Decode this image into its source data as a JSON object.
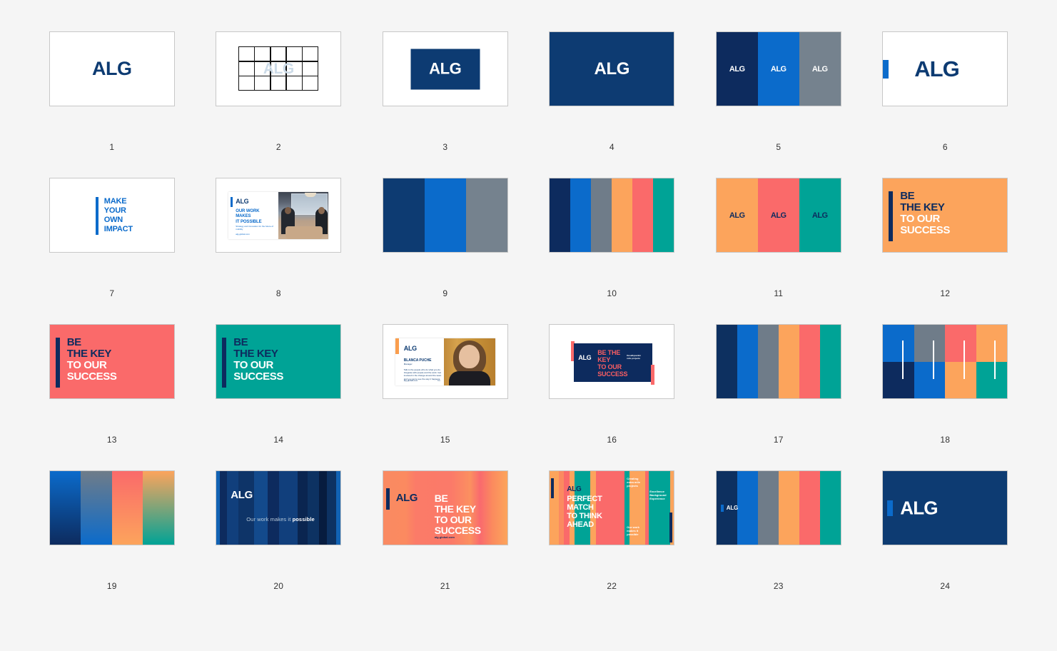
{
  "palette": {
    "page_background": "#f5f5f5",
    "navy": "#0d3b72",
    "deep_navy": "#0d2b5e",
    "blue": "#0b6bcb",
    "grey_blue": "#75828e",
    "orange": "#fca45c",
    "coral": "#fa6a6a",
    "teal": "#00a396",
    "caption_color": "#333333",
    "border": "#c8c8c8"
  },
  "brand": {
    "logo": "ALG",
    "tagline": "Our work makes it possible",
    "tagline_prefix": "Our work makes it ",
    "tagline_bold": "possible",
    "website": "alg-global.com"
  },
  "slogans": {
    "make_your_own_impact": [
      "MAKE",
      "YOUR",
      "OWN",
      "IMPACT"
    ],
    "be_the_key_dark": [
      "BE",
      "THE KEY"
    ],
    "be_the_key_light": [
      "TO OUR",
      "SUCCESS"
    ],
    "perfect_match": [
      "PERFECT",
      "MATCH",
      "TO THINK",
      "AHEAD"
    ],
    "our_work_makes_it_possible": [
      "OUR WORK",
      "MAKES",
      "IT POSSIBLE"
    ],
    "be_the_key_all": [
      "BE",
      "THE KEY",
      "TO OUR",
      "SUCCESS"
    ],
    "be_the_key_t16": [
      "BE THE",
      "KEY",
      "TO OUR",
      "SUCCESS"
    ]
  },
  "annotations": {
    "t16_sub": [
      "Desafiquentin",
      "ndis projecte"
    ],
    "t22_note_1": [
      "Creating",
      "extra mile",
      "projects"
    ],
    "t22_note_2": [
      "Our work",
      "makes it",
      "possible"
    ],
    "t22_note_3": [
      "Excellence",
      "Background",
      "Experience"
    ],
    "t15_name": "BLANCA PUCHE",
    "t15_role": "Manager",
    "t15_body": "Talk to the people who do what you do. Integrate with people and the work. Get involved in the change around the team and you get to see the way it happens.",
    "t15_foot_left": "alg-global.com",
    "t15_foot_right": "f in",
    "t8_sub": "Strategy and innovation for the future of mobility"
  },
  "tiles": [
    {
      "n": "1",
      "name": "logo-navy-on-white"
    },
    {
      "n": "2",
      "name": "logo-clearspace-grid"
    },
    {
      "n": "3",
      "name": "logo-navy-block-on-white"
    },
    {
      "n": "4",
      "name": "logo-white-on-navy"
    },
    {
      "n": "5",
      "name": "logo-three-colour-blocks-cool"
    },
    {
      "n": "6",
      "name": "logo-with-blue-bar"
    },
    {
      "n": "7",
      "name": "claim-make-your-own-impact"
    },
    {
      "n": "8",
      "name": "slide-our-work-makes-it-possible"
    },
    {
      "n": "9",
      "name": "palette-cool-three"
    },
    {
      "n": "10",
      "name": "palette-full-six"
    },
    {
      "n": "11",
      "name": "logo-three-colour-blocks-warm"
    },
    {
      "n": "12",
      "name": "claim-be-the-key-orange"
    },
    {
      "n": "13",
      "name": "claim-be-the-key-coral"
    },
    {
      "n": "14",
      "name": "claim-be-the-key-teal"
    },
    {
      "n": "15",
      "name": "slide-people-portrait"
    },
    {
      "n": "16",
      "name": "slide-be-the-key-navy"
    },
    {
      "n": "17",
      "name": "palette-full-six-b"
    },
    {
      "n": "18",
      "name": "palette-grid-with-lines"
    },
    {
      "n": "19",
      "name": "palette-gradients"
    },
    {
      "n": "20",
      "name": "slide-blue-stripes-tagline"
    },
    {
      "n": "21",
      "name": "slide-be-the-key-warm-gradient"
    },
    {
      "n": "22",
      "name": "slide-perfect-match-to-think-ahead"
    },
    {
      "n": "23",
      "name": "slide-logo-on-palette-stripes"
    },
    {
      "n": "24",
      "name": "slide-logo-white-on-navy"
    }
  ]
}
